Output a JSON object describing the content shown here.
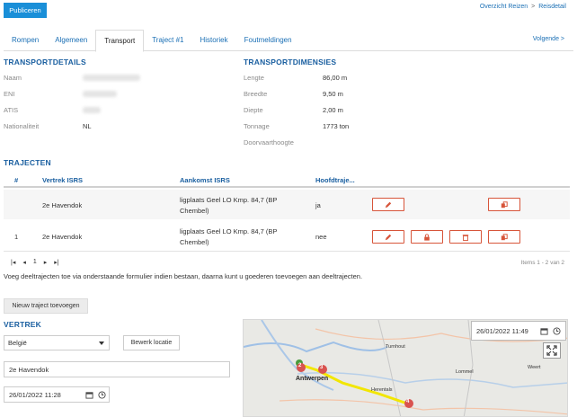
{
  "header": {
    "publish_label": "Publiceren",
    "breadcrumb": {
      "parent": "Overzicht Reizen",
      "separator": ">",
      "current": "Reisdetail"
    }
  },
  "tabs": [
    {
      "label": "Rompen"
    },
    {
      "label": "Algemeen"
    },
    {
      "label": "Transport"
    },
    {
      "label": "Traject #1"
    },
    {
      "label": "Historiek"
    },
    {
      "label": "Foutmeldingen"
    }
  ],
  "next_label": "Volgende >",
  "transportdetails": {
    "title": "TRANSPORTDETAILS",
    "fields": [
      {
        "label": "Naam",
        "value": ""
      },
      {
        "label": "ENI",
        "value": ""
      },
      {
        "label": "ATIS",
        "value": ""
      },
      {
        "label": "Nationaliteit",
        "value": "NL"
      }
    ]
  },
  "transportdimensies": {
    "title": "TRANSPORTDIMENSIES",
    "fields": [
      {
        "label": "Lengte",
        "value": "86,00 m"
      },
      {
        "label": "Breedte",
        "value": "9,50 m"
      },
      {
        "label": "Diepte",
        "value": "2,00 m"
      },
      {
        "label": "Tonnage",
        "value": "1773 ton"
      },
      {
        "label": "Doorvaarthoogte",
        "value": ""
      }
    ]
  },
  "trajecten": {
    "title": "TRAJECTEN",
    "columns": [
      "#",
      "Vertrek ISRS",
      "Aankomst ISRS",
      "Hoofdtraje..."
    ],
    "rows": [
      {
        "num": "",
        "vertrek": "2e Havendok",
        "aankomst_1": "ligplaats Geel LO Kmp. 84,7 (BP",
        "aankomst_2": "Chembel)",
        "hoofd": "ja"
      },
      {
        "num": "1",
        "vertrek": "2e Havendok",
        "aankomst_1": "ligplaats Geel LO Kmp. 84,7 (BP",
        "aankomst_2": "Chembel)",
        "hoofd": "nee"
      }
    ],
    "pager": {
      "first": "|◂",
      "prev": "◂",
      "page": "1",
      "next": "▸",
      "last": "▸|"
    },
    "pager_info": "Items 1 - 2 van 2"
  },
  "hint": "Voeg deeltrajecten toe via onderstaande formulier indien bestaan, daarna kunt u goederen toevoegen aan deeltrajecten.",
  "new_traject_label": "Nieuw traject toevoegen",
  "vertrek": {
    "title": "VERTREK",
    "country": "België",
    "edit_location_label": "Bewerk locatie",
    "location": "2e Havendok",
    "datetime": "26/01/2022 11:28"
  },
  "map": {
    "datetime": "26/01/2022 11:49",
    "places": [
      "Antwerpen",
      "Turnhout",
      "Herentals",
      "Lommel",
      "Weert"
    ],
    "markers": [
      "2",
      "3",
      "4"
    ],
    "colors": {
      "route": "#f2e600",
      "marker_red": "#d9534f",
      "marker_green": "#4a9b3e"
    }
  },
  "colors": {
    "accent": "#1a8fd8",
    "title_blue": "#1a5fa0",
    "action_red": "#d7553a"
  }
}
